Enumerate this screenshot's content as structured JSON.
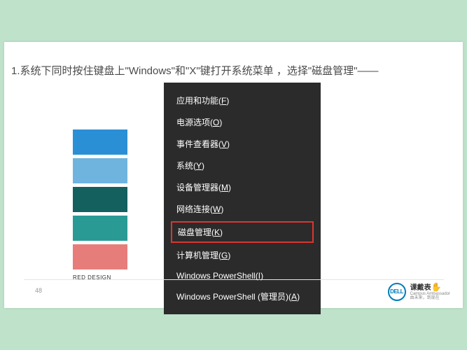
{
  "title": "1.系统下同时按住键盘上\"Windows\"和\"X\"键打开系统菜单 ，选择\"磁盘管理\"——",
  "swatches": [
    {
      "color": "#2b8fd6"
    },
    {
      "color": "#6fb4df"
    },
    {
      "color": "#14605f"
    },
    {
      "color": "#2a9a94"
    },
    {
      "color": "#e77d7a"
    }
  ],
  "swatch_label": "RED DESIGN",
  "menu": {
    "items": [
      {
        "label": "应用和功能",
        "key": "F",
        "highlight": false
      },
      {
        "label": "电源选项",
        "key": "O",
        "highlight": false
      },
      {
        "label": "事件查看器",
        "key": "V",
        "highlight": false
      },
      {
        "label": "系统",
        "key": "Y",
        "highlight": false
      },
      {
        "label": "设备管理器",
        "key": "M",
        "highlight": false
      },
      {
        "label": "网络连接",
        "key": "W",
        "highlight": false
      },
      {
        "label": "磁盘管理",
        "key": "K",
        "highlight": true
      },
      {
        "label": "计算机管理",
        "key": "G",
        "highlight": false
      },
      {
        "label": "Windows PowerShell",
        "key": "I",
        "highlight": false
      },
      {
        "label": "Windows PowerShell (管理员)",
        "key": "A",
        "highlight": false
      }
    ]
  },
  "page_number": "48",
  "footer": {
    "dell": "DELL",
    "partner_main": "课戴表",
    "partner_sub": "由未来，到现在",
    "partner_en": "Campus Ambassador"
  }
}
